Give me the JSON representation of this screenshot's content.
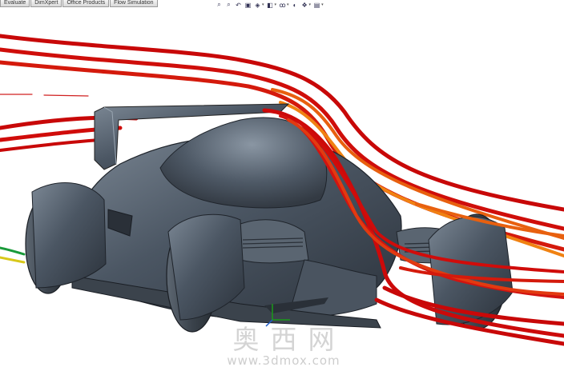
{
  "tabs": [
    {
      "label": "Evaluate"
    },
    {
      "label": "DimXpert"
    },
    {
      "label": "Office Products"
    },
    {
      "label": "Flow Simulation"
    }
  ],
  "toolbar": {
    "icons": [
      "zoom-to-fit-icon",
      "zoom-to-area-icon",
      "previous-view-icon",
      "section-view-icon",
      "view-orientation-icon",
      "display-style-icon",
      "hide-show-items-icon",
      "edit-appearance-icon",
      "apply-scene-icon",
      "view-settings-icon"
    ]
  },
  "viewport": {
    "model": "race-car",
    "flow_colors": [
      "#cc0a0a",
      "#e23a10",
      "#f07a14"
    ],
    "body_color": "#4a5460"
  },
  "watermark": {
    "chinese": "奥西网",
    "url": "www.3dmox.com"
  }
}
